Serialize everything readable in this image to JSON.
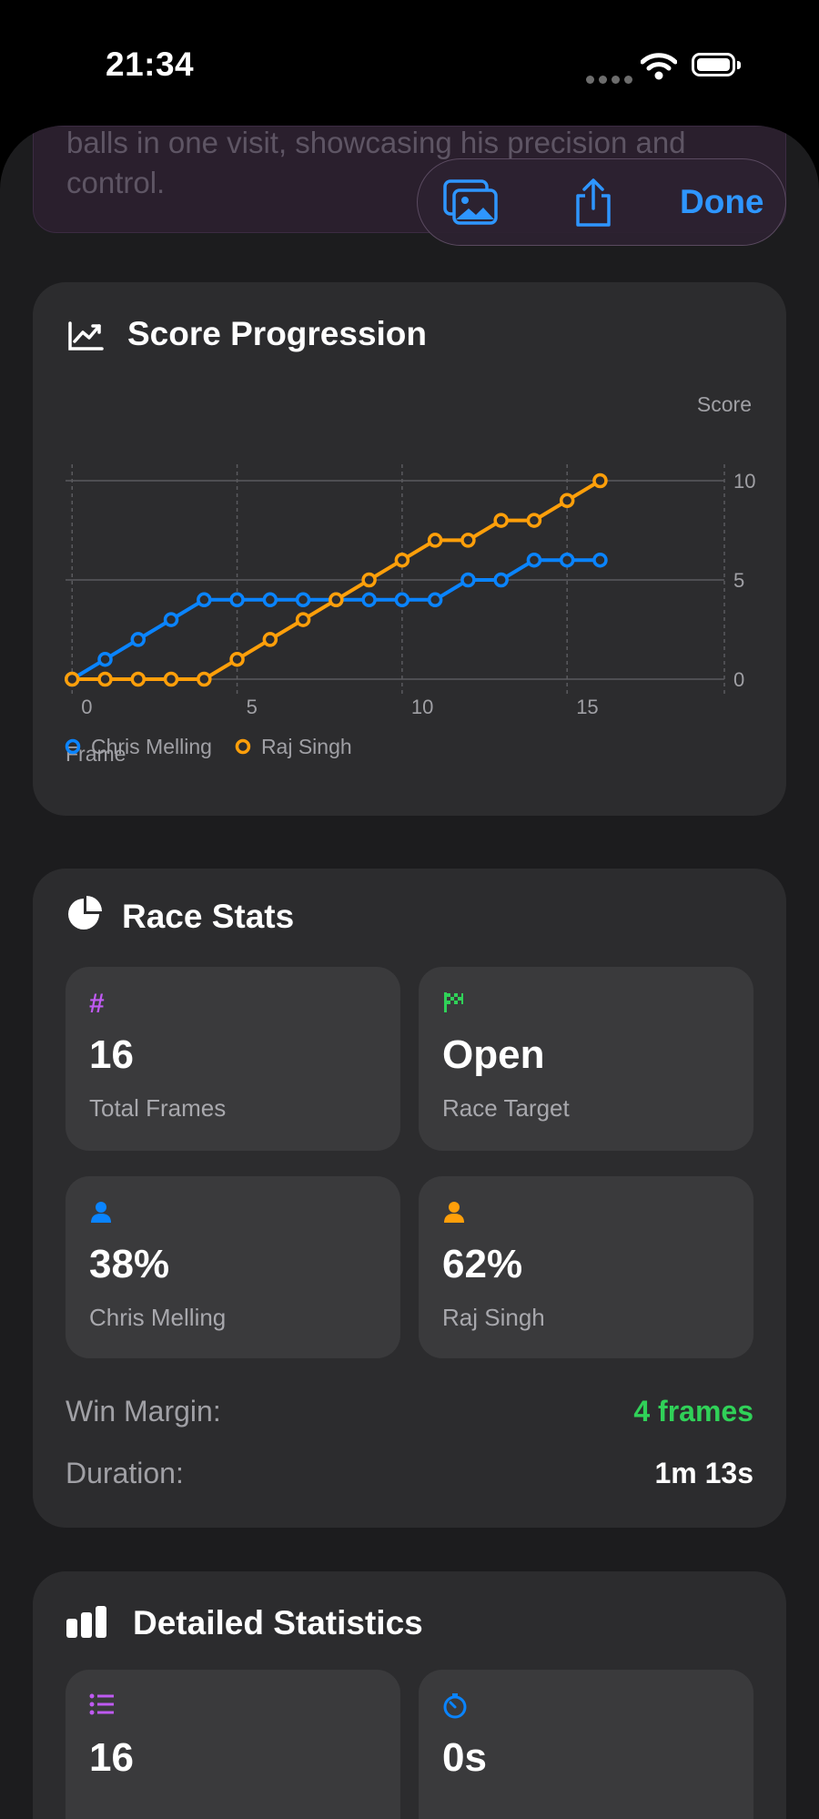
{
  "status": {
    "time": "21:34"
  },
  "previous_card": {
    "text": "balls in one visit, showcasing his precision and control."
  },
  "toolbar": {
    "done_label": "Done"
  },
  "score_progression": {
    "title": "Score Progression",
    "icon": "chart-line-icon"
  },
  "chart_data": {
    "type": "line",
    "title": "Score Progression",
    "xlabel": "Frame",
    "ylabel": "Score",
    "xlim": [
      -0.2,
      19.6
    ],
    "ylim": [
      0,
      10
    ],
    "x_ticks": [
      0,
      5,
      10,
      15
    ],
    "y_ticks": [
      0,
      5,
      10
    ],
    "y_axis_side": "right",
    "grid": true,
    "legend_position": "bottom-left",
    "series": [
      {
        "name": "Chris Melling",
        "color": "#0a84ff",
        "x": [
          0,
          1,
          2,
          3,
          4,
          5,
          6,
          7,
          8,
          9,
          10,
          11,
          12,
          13,
          14,
          15,
          16
        ],
        "values": [
          0,
          1,
          2,
          3,
          4,
          4,
          4,
          4,
          4,
          4,
          4,
          4,
          5,
          5,
          6,
          6,
          6
        ]
      },
      {
        "name": "Raj Singh",
        "color": "#ff9f0a",
        "x": [
          0,
          1,
          2,
          3,
          4,
          5,
          6,
          7,
          8,
          9,
          10,
          11,
          12,
          13,
          14,
          15,
          16
        ],
        "values": [
          0,
          0,
          0,
          0,
          0,
          1,
          2,
          3,
          4,
          5,
          6,
          7,
          7,
          8,
          8,
          9,
          10
        ]
      }
    ]
  },
  "race_stats": {
    "title": "Race Stats",
    "tiles": [
      {
        "icon": "hash-icon",
        "color": "#bf5af2",
        "value": "16",
        "label": "Total Frames"
      },
      {
        "icon": "checkered-flag-icon",
        "color": "#30d158",
        "value": "Open",
        "label": "Race Target"
      },
      {
        "icon": "person-icon",
        "color": "#0a84ff",
        "value": "38%",
        "label": "Chris Melling"
      },
      {
        "icon": "person-icon",
        "color": "#ff9f0a",
        "value": "62%",
        "label": "Raj Singh"
      }
    ],
    "win_margin_label": "Win Margin:",
    "win_margin_value": "4 frames",
    "win_margin_color": "#30d158",
    "duration_label": "Duration:",
    "duration_value": "1m 13s"
  },
  "detailed_statistics": {
    "title": "Detailed Statistics",
    "tiles": [
      {
        "icon": "list-icon",
        "color": "#bf5af2",
        "value": "16"
      },
      {
        "icon": "timer-icon",
        "color": "#0a84ff",
        "value": "0s"
      }
    ]
  }
}
